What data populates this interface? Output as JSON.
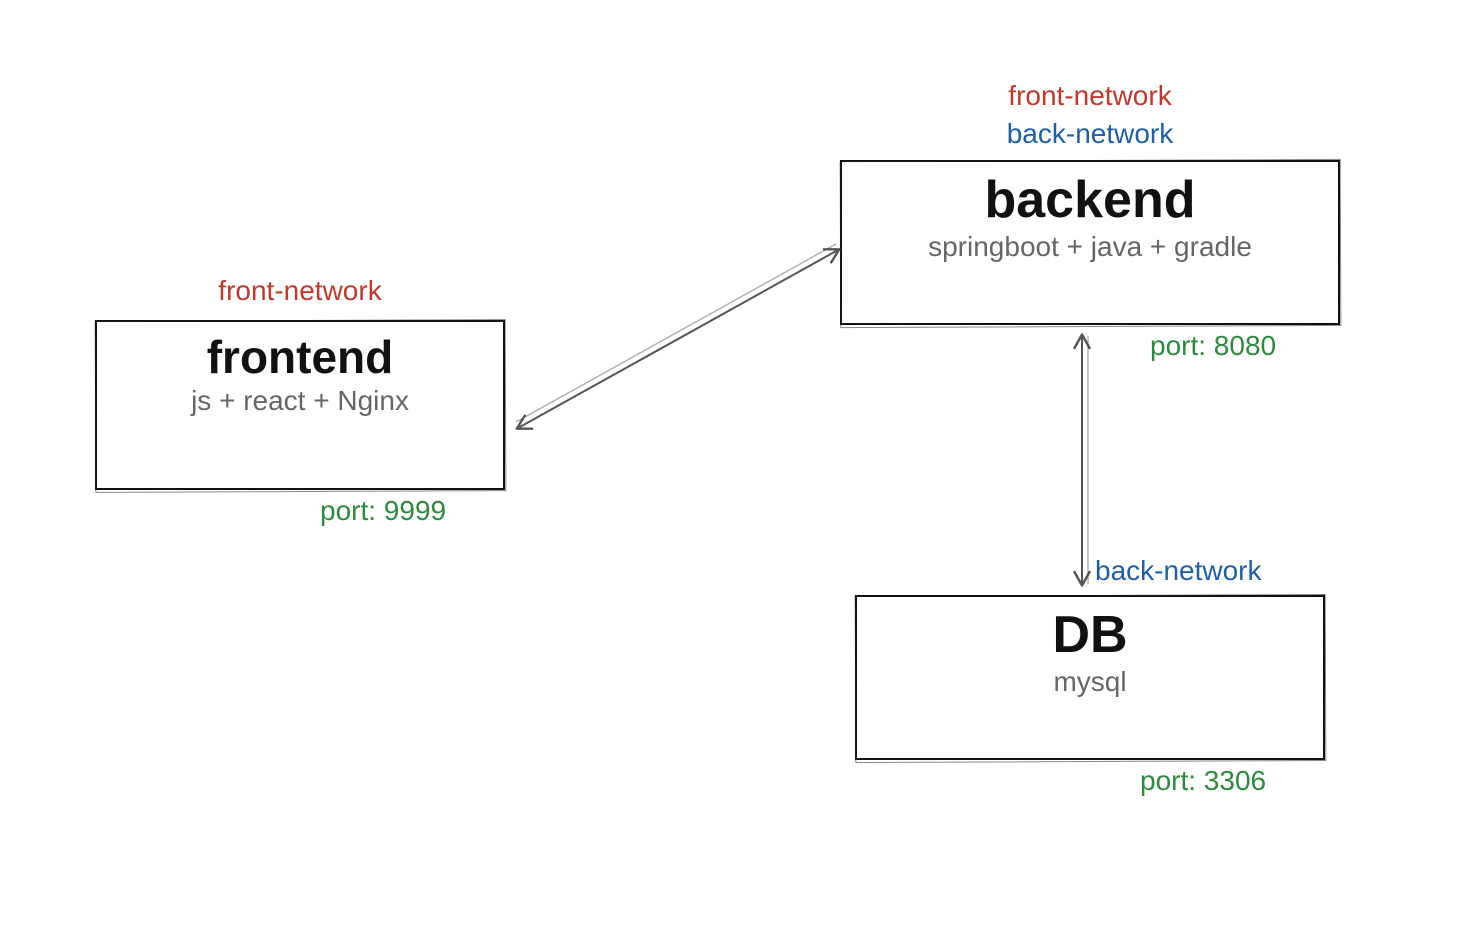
{
  "nodes": {
    "frontend": {
      "title": "frontend",
      "tech": "js + react + Nginx",
      "networks_above": [
        "front-network"
      ],
      "port_label": "port: 9999"
    },
    "backend": {
      "title": "backend",
      "tech": "springboot + java + gradle",
      "networks_above": [
        "front-network",
        "back-network"
      ],
      "port_label": "port: 8080"
    },
    "db": {
      "title": "DB",
      "tech": "mysql",
      "networks_above": [
        "back-network"
      ],
      "port_label": "port: 3306"
    }
  },
  "edges": [
    {
      "from": "frontend",
      "to": "backend",
      "bidirectional": true
    },
    {
      "from": "backend",
      "to": "db",
      "bidirectional": true
    }
  ],
  "colors": {
    "front_network": "#c0392b",
    "back_network": "#1f5fa8",
    "port": "#2e8b3d",
    "box_border": "#111111",
    "tech_text": "#666666"
  }
}
